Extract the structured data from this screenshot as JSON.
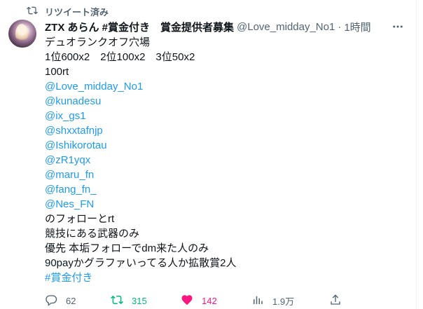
{
  "retweet_context": {
    "label": "リツイート済み"
  },
  "author": {
    "display_name": "ZTX あらん #賞金付き　賞金提供者募集",
    "handle": "@Love_midday_No1",
    "separator": "·",
    "time": "1時間"
  },
  "tweet": {
    "lines": [
      {
        "text": "デュオランクオフ穴場",
        "type": "text"
      },
      {
        "text": "1位600x2　2位100x2　3位50x2",
        "type": "text"
      },
      {
        "text": "100rt",
        "type": "text"
      },
      {
        "text": "@Love_midday_No1",
        "type": "mention"
      },
      {
        "text": "@kunadesu",
        "type": "mention"
      },
      {
        "text": "@ix_gs1",
        "type": "mention"
      },
      {
        "text": "@shxxtafnjp",
        "type": "mention"
      },
      {
        "text": "@Ishikorotau",
        "type": "mention"
      },
      {
        "text": "@zR1yqx",
        "type": "mention"
      },
      {
        "text": "@maru_fn",
        "type": "mention"
      },
      {
        "text": "@fang_fn_",
        "type": "mention"
      },
      {
        "text": "@Nes_FN",
        "type": "mention"
      },
      {
        "text": "のフォローとrt",
        "type": "text"
      },
      {
        "text": "競技にある武器のみ",
        "type": "text"
      },
      {
        "text": "優先 本垢フォローでdm来た人のみ",
        "type": "text"
      },
      {
        "text": "90payかグラファいってる人か拡散賞2人",
        "type": "text"
      },
      {
        "text": "#賞金付き",
        "type": "hashtag"
      }
    ]
  },
  "actions": {
    "reply_count": "62",
    "retweet_count": "315",
    "like_count": "142",
    "views_count": "1.9万"
  },
  "colors": {
    "link": "#1d9bf0",
    "retweet_active": "#00ba7c",
    "like_active": "#f91880",
    "muted": "#536471"
  },
  "icons": [
    "retweet-icon",
    "more-icon",
    "reply-icon",
    "retweet-icon",
    "like-icon",
    "views-icon",
    "share-icon"
  ]
}
